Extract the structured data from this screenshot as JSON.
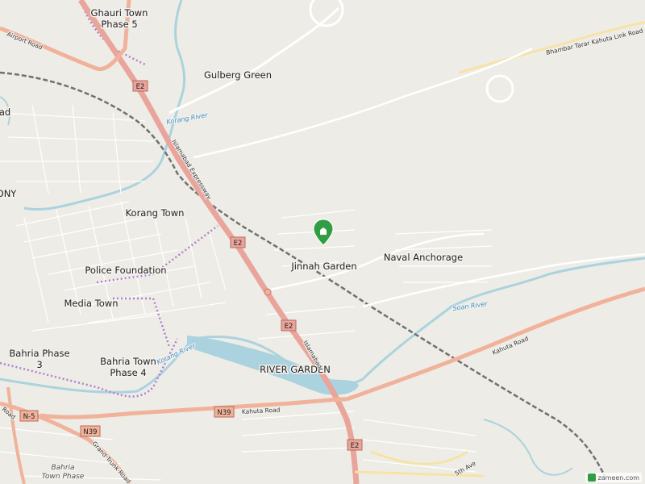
{
  "map": {
    "places": [
      {
        "name": "ghauri-town-label",
        "lines": [
          "Ghauri Town",
          "Phase 5"
        ]
      },
      {
        "name": "gulberg-green-label",
        "lines": [
          "Gulberg Green"
        ]
      },
      {
        "name": "korang-town-label",
        "lines": [
          "Korang Town"
        ]
      },
      {
        "name": "police-foundation-label",
        "lines": [
          "Police Foundation"
        ]
      },
      {
        "name": "media-town-label",
        "lines": [
          "Media Town"
        ]
      },
      {
        "name": "bahria-phase-3-label",
        "lines": [
          "Bahria Phase",
          "3"
        ]
      },
      {
        "name": "bahria-town-phase-4-label",
        "lines": [
          "Bahria Town",
          "Phase 4"
        ]
      },
      {
        "name": "river-garden-label",
        "lines": [
          "RIVER GARDEN"
        ]
      },
      {
        "name": "jinnah-garden-label",
        "lines": [
          "Jinnah Garden"
        ]
      },
      {
        "name": "naval-anchorage-label",
        "lines": [
          "Naval Anchorage"
        ]
      },
      {
        "name": "ony-label",
        "lines": [
          "ONY"
        ]
      },
      {
        "name": "ad-label",
        "lines": [
          "ad"
        ]
      },
      {
        "name": "bahria-town-phase-lower-label",
        "lines": [
          "Bahria",
          "Town Phase"
        ]
      }
    ],
    "roads": [
      {
        "name": "airport-road-label",
        "text": "Airport Road"
      },
      {
        "name": "islamabad-expressway-label",
        "text": "Islamabad Expressway"
      },
      {
        "name": "kahuta-road-east-label",
        "text": "Kahuta Road"
      },
      {
        "name": "kahuta-road-west-label",
        "text": "Kahuta Road"
      },
      {
        "name": "bhambar-tarar-road-label",
        "text": "Bhambar Tarar Kahuta Link Road"
      },
      {
        "name": "grand-trunk-road-label",
        "text": "Grand Trunk Road"
      },
      {
        "name": "5th-ave-label",
        "text": "5th Ave"
      },
      {
        "name": "road-left-label",
        "text": "Road"
      },
      {
        "name": "expressway-lower-label",
        "text": "Islamabad"
      }
    ],
    "rivers": [
      {
        "name": "korang-river-upper-label",
        "text": "Korang River"
      },
      {
        "name": "korang-river-lower-label",
        "text": "Korang River"
      },
      {
        "name": "soan-river-label",
        "text": "Soan River"
      }
    ],
    "shields": [
      {
        "name": "e2-shield-1",
        "text": "E2"
      },
      {
        "name": "e2-shield-2",
        "text": "E2"
      },
      {
        "name": "e2-shield-3",
        "text": "E2"
      },
      {
        "name": "e2-shield-4",
        "text": "E2"
      },
      {
        "name": "n39-shield-1",
        "text": "N39"
      },
      {
        "name": "n39-shield-2",
        "text": "N39"
      },
      {
        "name": "n5-shield",
        "text": "N-5"
      }
    ],
    "colors": {
      "background": "#eeece6",
      "motorway": "#e9a59b",
      "primary": "#f0b29a",
      "secondary": "#f6e3a5",
      "water": "#aad3df",
      "railway": "#707070",
      "boundary": "#b07ecf",
      "marker": "#2f9e44"
    },
    "marker": {
      "icon": "location-pin-icon"
    }
  },
  "watermark": {
    "text": "zameen.com",
    "icon": "zameen-logo-icon"
  }
}
